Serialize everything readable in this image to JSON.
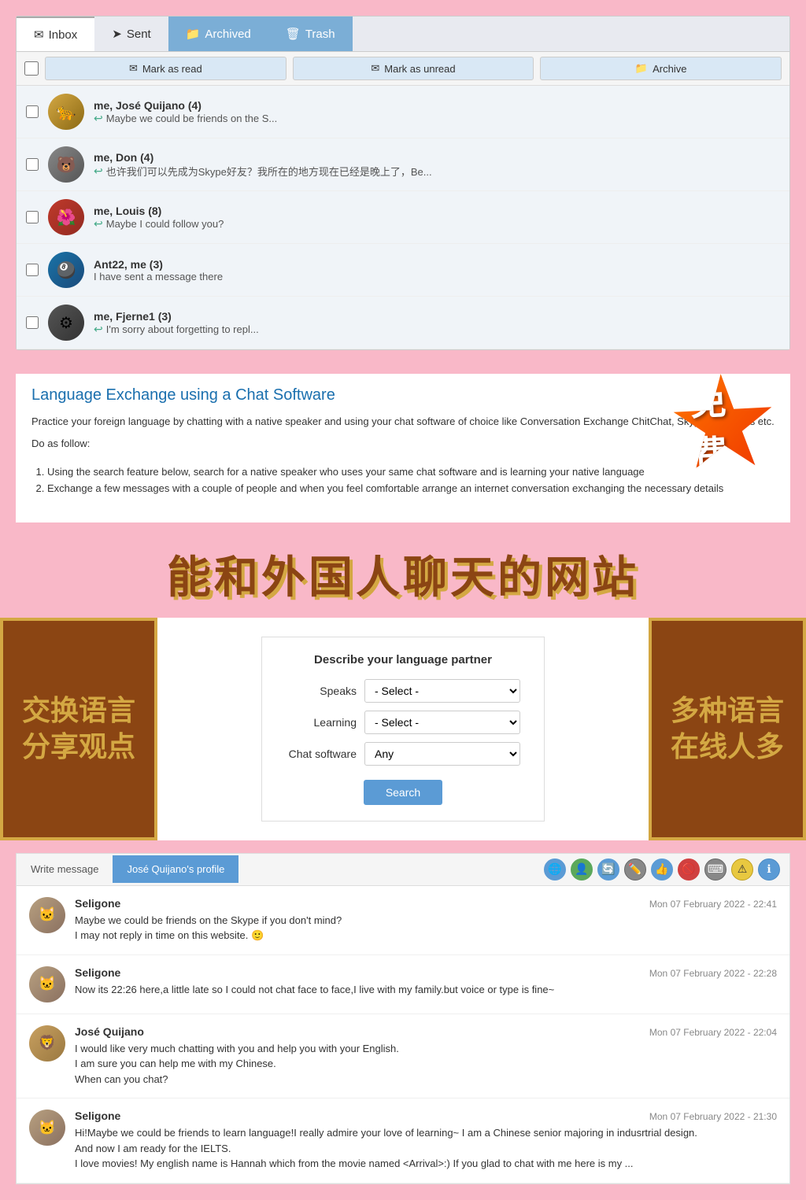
{
  "tabs": {
    "inbox": "Inbox",
    "sent": "Sent",
    "archived": "Archived",
    "trash": "Trash"
  },
  "actions": {
    "mark_read": "Mark as read",
    "mark_unread": "Mark as unread",
    "archive": "Archive"
  },
  "messages": [
    {
      "sender": "me, José Quijano (4)",
      "preview": "Maybe we could be friends on the S...",
      "has_reply": true,
      "avatar_type": "jose"
    },
    {
      "sender": "me, Don (4)",
      "preview": "也许我们可以先成为Skype好友？我所在的地方现在已经是晚上了，Be...",
      "has_reply": true,
      "avatar_type": "don"
    },
    {
      "sender": "me, Louis (8)",
      "preview": "Maybe I could follow you?",
      "has_reply": true,
      "avatar_type": "louis"
    },
    {
      "sender": "Ant22, me (3)",
      "preview": "I have sent a message there",
      "has_reply": false,
      "avatar_type": "ant"
    },
    {
      "sender": "me, Fjerne1 (3)",
      "preview": "I'm sorry about forgetting to repl...",
      "has_reply": true,
      "avatar_type": "fjerne"
    }
  ],
  "lang_section": {
    "title": "Language Exchange using a Chat Software",
    "desc": "Practice your foreign language by chatting with a native speaker and using your chat software of choice like Conversation Exchange ChitChat, Skype, Hangouts etc.",
    "do_as": "Do as follow:",
    "steps": [
      "Using the search feature below, search for a native speaker who uses your same chat software and is learning your native language",
      "Exchange a few messages with a couple of people and when you feel comfortable arrange an internet conversation exchanging the necessary details"
    ]
  },
  "search_form": {
    "title": "Describe your language partner",
    "speaks_label": "Speaks",
    "learning_label": "Learning",
    "chat_label": "Chat software",
    "speaks_default": "- Select -",
    "learning_default": "- Select -",
    "chat_default": "Any",
    "search_btn": "Search"
  },
  "chat": {
    "tab_write": "Write message",
    "tab_profile": "José Quijano's profile",
    "messages": [
      {
        "sender": "Seligone",
        "time": "Mon 07 February 2022 - 22:41",
        "text": "Maybe we could be friends on the Skype if you don't mind?\nI may not reply in time on this website. 🙂",
        "avatar_type": "seligone"
      },
      {
        "sender": "Seligone",
        "time": "Mon 07 February 2022 - 22:28",
        "text": "Now its 22:26 here,a little late so I could not chat face to face,I live with my family.but voice or type is fine~",
        "avatar_type": "seligone"
      },
      {
        "sender": "José Quijano",
        "time": "Mon 07 February 2022 - 22:04",
        "text": "I would like very much chatting with you and help you with your English.\nI am sure you can help me with my Chinese.\nWhen can you chat?",
        "avatar_type": "quijano"
      },
      {
        "sender": "Seligone",
        "time": "Mon 07 February 2022 - 21:30",
        "text": "Hi!Maybe we could be friends to learn language!I really admire your love of learning~ I am a Chinese senior majoring in indusrtrial design.\nAnd now I am ready for the IELTS.\nI love movies! My english name is Hannah which from the movie named <Arrival>:) If you glad to chat with me here is my ...",
        "avatar_type": "seligone"
      }
    ]
  },
  "promo": {
    "free_badge": "免费",
    "line1": "能和外国人聊天的网站",
    "side_left_1": "交换语言",
    "side_left_2": "分享观点",
    "side_right_1": "多种语言",
    "side_right_2": "在线人多"
  }
}
